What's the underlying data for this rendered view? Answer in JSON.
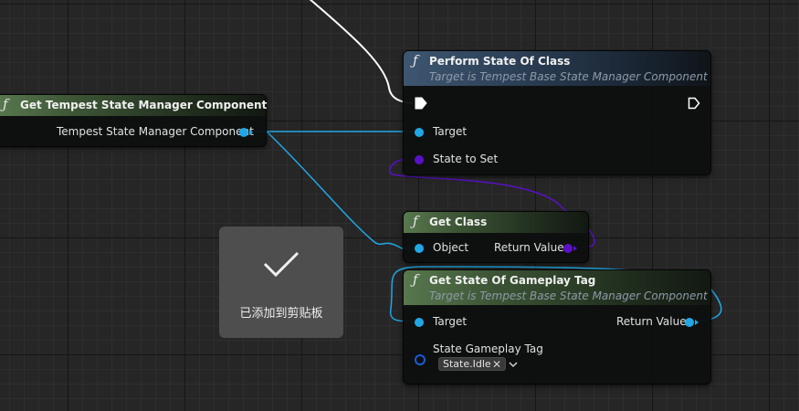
{
  "nodes": {
    "get_component": {
      "fn_icon": "ƒ",
      "title": "Get Tempest State Manager Component",
      "output_pin": "Tempest State Manager Component"
    },
    "perform_state": {
      "fn_icon": "ƒ",
      "title": "Perform State Of Class",
      "subtitle": "Target is Tempest Base State Manager Component",
      "pins": {
        "target": "Target",
        "state_to_set": "State to Set"
      }
    },
    "get_class": {
      "fn_icon": "ƒ",
      "title": "Get Class",
      "pins": {
        "object": "Object",
        "return_value": "Return Value"
      }
    },
    "get_state_tag": {
      "fn_icon": "ƒ",
      "title": "Get State Of Gameplay Tag",
      "subtitle": "Target is Tempest Base State Manager Component",
      "pins": {
        "target": "Target",
        "return_value": "Return Value",
        "state_gameplay_tag": "State Gameplay Tag"
      },
      "tag_value": "State.Idle",
      "tag_clear": "✕"
    }
  },
  "toast": {
    "icon": "check-icon",
    "message": "已添加到剪贴板"
  },
  "colors": {
    "exec_wire": "#ffffff",
    "object_wire": "#20a8e6",
    "class_wire": "#5a10c8"
  }
}
